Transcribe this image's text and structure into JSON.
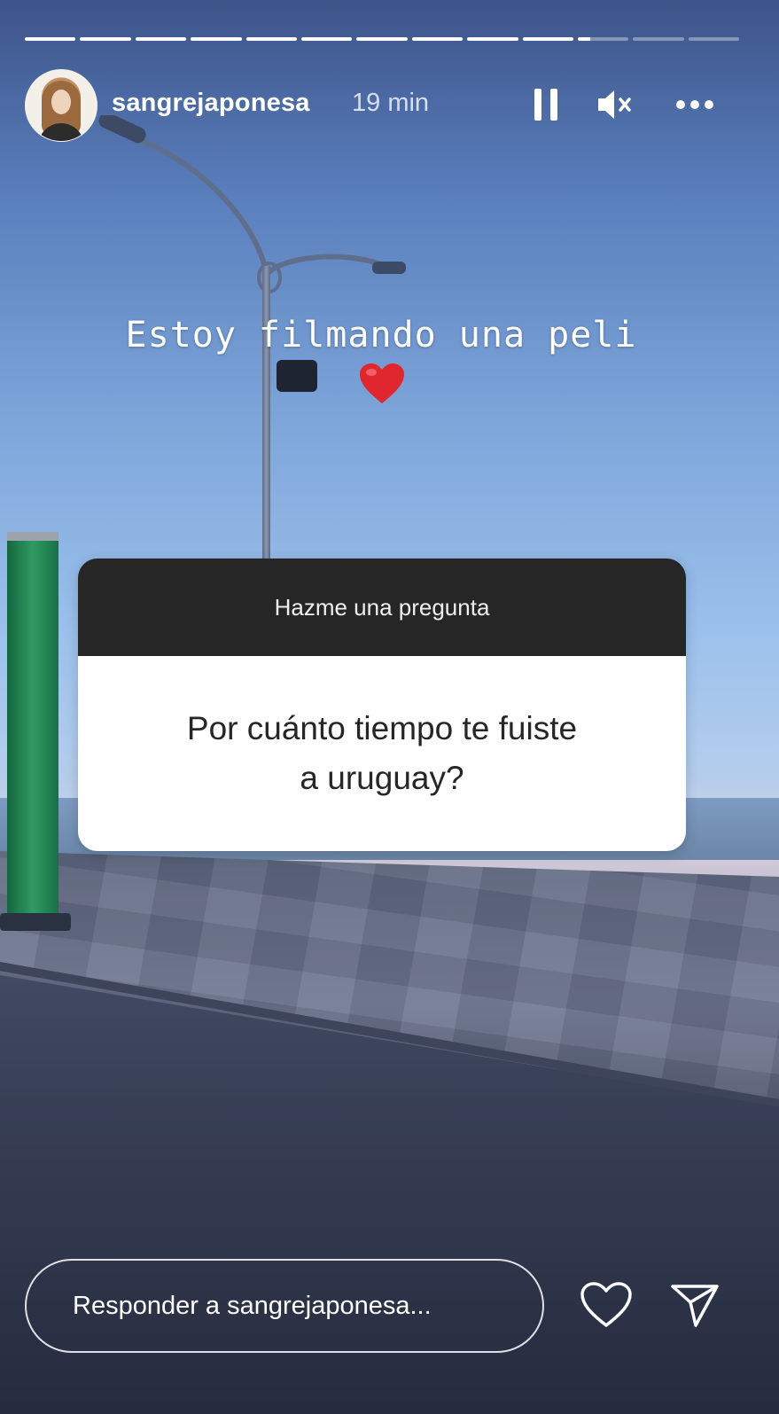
{
  "story": {
    "segments": [
      1,
      1,
      1,
      1,
      1,
      1,
      1,
      1,
      1,
      1,
      0.25,
      0,
      0
    ],
    "user": {
      "username": "sangrejaponesa",
      "time": "19 min"
    },
    "icons": {
      "pause": "pause-icon",
      "mute": "volume-muted-icon",
      "more": "more-options-icon"
    },
    "caption": {
      "text": "Estoy filmando una peli",
      "emoji": "red-heart-emoji"
    },
    "question_sticker": {
      "header": "Hazme una pregunta",
      "question_line1": "Por cuánto tiempo te fuiste",
      "question_line2": "a uruguay?"
    },
    "footer": {
      "reply_placeholder": "Responder a sangrejaponesa...",
      "like_icon": "heart-icon",
      "share_icon": "send-icon"
    },
    "colors": {
      "sticker_header": "#262626",
      "sticker_body": "#ffffff",
      "heart": "#e0262f"
    }
  }
}
